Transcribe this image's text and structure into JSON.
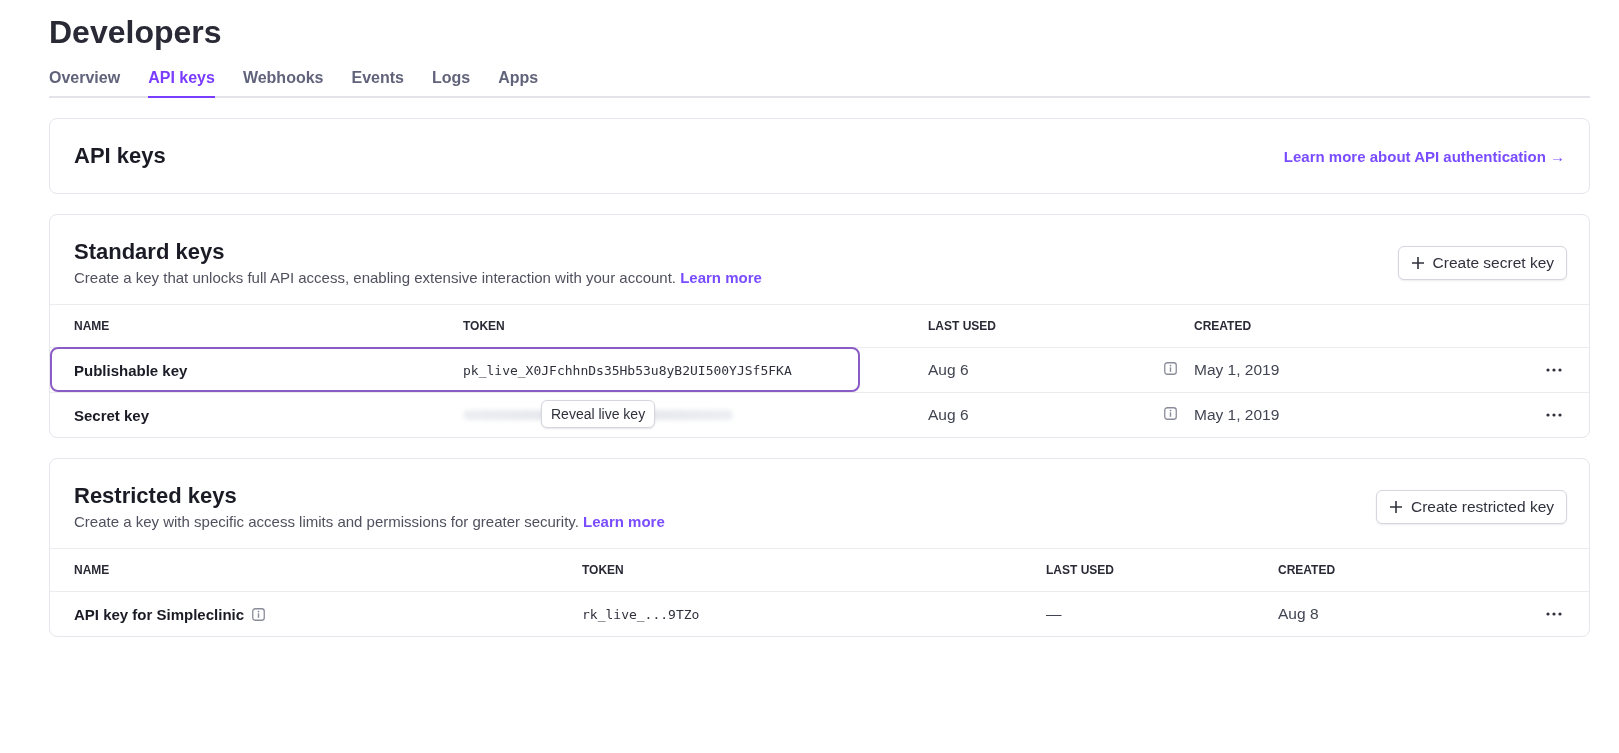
{
  "page_title": "Developers",
  "tabs": [
    {
      "label": "Overview",
      "selected": false
    },
    {
      "label": "API keys",
      "selected": true
    },
    {
      "label": "Webhooks",
      "selected": false
    },
    {
      "label": "Events",
      "selected": false
    },
    {
      "label": "Logs",
      "selected": false
    },
    {
      "label": "Apps",
      "selected": false
    }
  ],
  "header_card": {
    "title": "API keys",
    "link": "Learn more about API authentication →"
  },
  "sections": [
    {
      "kind": "standard",
      "title": "Standard keys",
      "description": "Create a key that unlocks full API access, enabling extensive interaction with your account.",
      "link": "Learn more",
      "button": "Create secret key",
      "columns": [
        "NAME",
        "TOKEN",
        "LAST USED",
        "CREATED"
      ],
      "rows": [
        {
          "name": "Publishable key",
          "name_info": false,
          "kind": "plain",
          "token": "pk_live_X0JFchhnDs35Hb53u8yB2UI500YJSf5FKA",
          "last_used": "Aug 6",
          "last_used_info": true,
          "created": "May 1, 2019",
          "highlighted": true
        },
        {
          "name": "Secret key",
          "name_info": false,
          "kind": "hidden",
          "reveal_button": "Reveal live key",
          "last_used": "Aug 6",
          "last_used_info": true,
          "created": "May 1, 2019",
          "highlighted": false
        }
      ]
    },
    {
      "kind": "restricted",
      "title": "Restricted keys",
      "description": "Create a key with specific access limits and permissions for greater security.",
      "link": "Learn more",
      "button": "Create restricted key",
      "columns": [
        "NAME",
        "TOKEN",
        "LAST USED",
        "CREATED"
      ],
      "rows": [
        {
          "name": "API key for Simpleclinic",
          "name_info": true,
          "kind": "plain",
          "token": "rk_live_...9TZo",
          "last_used": "—",
          "last_used_info": false,
          "created": "Aug 8",
          "highlighted": false
        }
      ]
    }
  ]
}
